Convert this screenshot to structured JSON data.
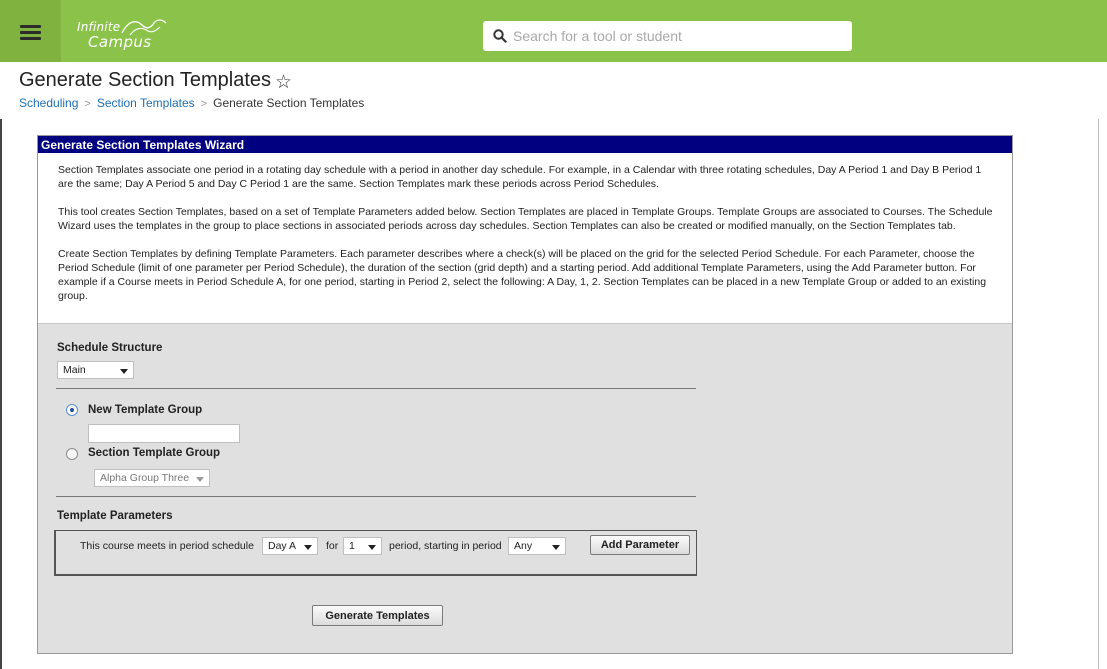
{
  "topbar": {
    "logo_line1": "Infinite",
    "logo_line2": "Campus",
    "search_placeholder": "Search for a tool or student",
    "brand_color": "#8bc34a"
  },
  "header": {
    "title": "Generate Section Templates",
    "breadcrumb": [
      "Scheduling",
      "Section Templates",
      "Generate Section Templates"
    ]
  },
  "wizard": {
    "title": "Generate Section Templates Wizard",
    "header_color": "#000080",
    "paragraphs": [
      "Section Templates associate one period in a rotating day schedule with a period in another day schedule. For example, in a Calendar with three rotating schedules, Day A Period 1 and Day B Period 1 are the same; Day A Period 5 and Day C Period 1 are the same. Section Templates mark these periods across Period Schedules.",
      "This tool creates Section Templates, based on a set of Template Parameters added below. Section Templates are placed in Template Groups. Template Groups are associated to Courses. The Schedule Wizard uses the templates in the group to place sections in associated periods across day schedules. Section Templates can also be created or modified manually, on the Section Templates tab.",
      "Create Section Templates by defining Template Parameters. Each parameter describes where a check(s) will be placed on the grid for the selected Period Schedule. For each Parameter, choose the Period Schedule (limit of one parameter per Period Schedule), the duration of the section (grid depth) and a starting period. Add additional Template Parameters, using the Add Parameter button. For example if a Course meets in Period Schedule A, for one period, starting in Period 2, select the following: A Day, 1, 2. Section Templates can be placed in a new Template Group or added to an existing group."
    ],
    "schedule_structure": {
      "label": "Schedule Structure",
      "value": "Main"
    },
    "new_group": {
      "label": "New Template Group",
      "value": "",
      "selected": true
    },
    "existing_group": {
      "label": "Section Template Group",
      "value": "Alpha Group Three",
      "selected": false
    },
    "params": {
      "label": "Template Parameters",
      "text_meets": "This course meets in period schedule",
      "schedule_value": "Day A",
      "text_for": "for",
      "duration_value": "1",
      "text_starting": "period, starting in period",
      "start_value": "Any",
      "add_button": "Add Parameter"
    },
    "generate_button": "Generate Templates"
  }
}
